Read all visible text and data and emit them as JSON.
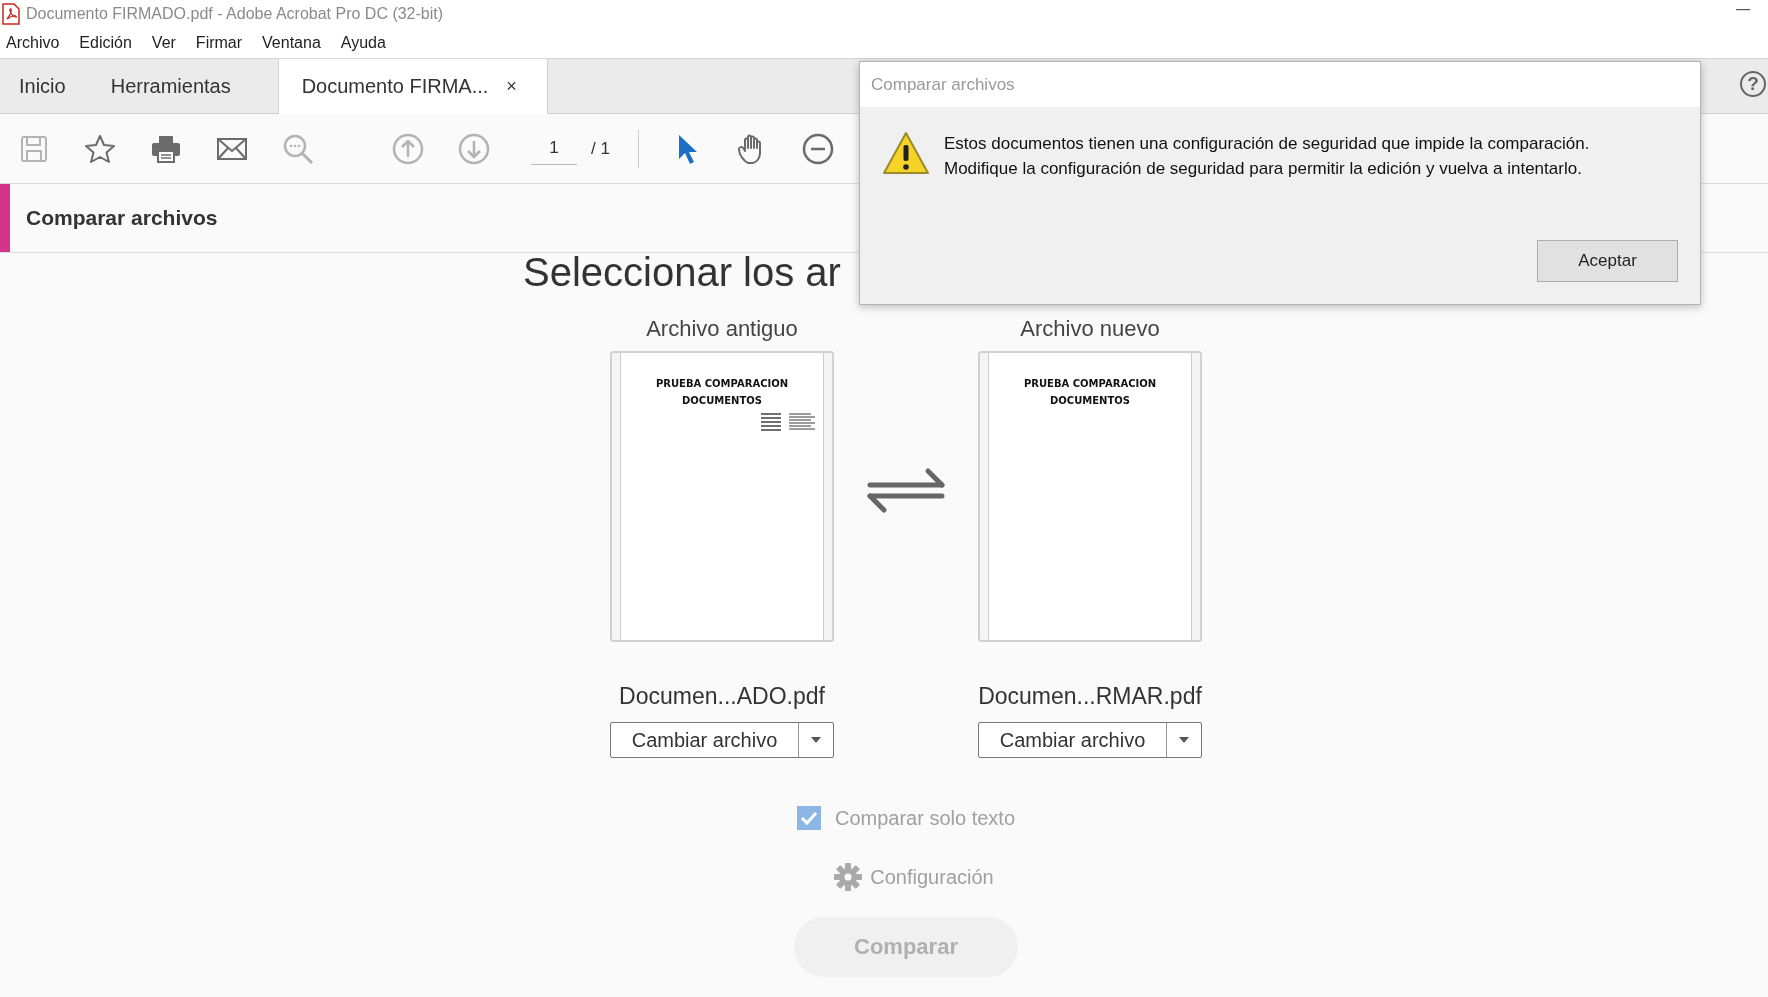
{
  "window": {
    "title": "Documento FIRMADO.pdf - Adobe Acrobat Pro DC (32-bit)"
  },
  "menu": [
    "Archivo",
    "Edición",
    "Ver",
    "Firmar",
    "Ventana",
    "Ayuda"
  ],
  "tabs": [
    {
      "label": "Inicio",
      "selected": false
    },
    {
      "label": "Herramientas",
      "selected": false
    },
    {
      "label": "Documento FIRMA...",
      "selected": true,
      "close": "×"
    }
  ],
  "help": "?",
  "toolbar": {
    "tools": [
      {
        "kind": "save",
        "disabled": true
      },
      {
        "kind": "star",
        "disabled": false
      },
      {
        "kind": "print",
        "disabled": false
      },
      {
        "kind": "mail",
        "disabled": false
      },
      {
        "kind": "search",
        "disabled": true
      },
      {
        "kind": "up",
        "disabled": true
      },
      {
        "kind": "down",
        "disabled": true
      },
      {
        "kind": "page"
      },
      {
        "kind": "separator"
      },
      {
        "kind": "pointer",
        "disabled": false,
        "selected": true
      },
      {
        "kind": "hand",
        "disabled": false,
        "selected": false
      },
      {
        "kind": "zoomout",
        "disabled": false
      }
    ],
    "page": "1",
    "page_total": "/ 1"
  },
  "tool_panel": {
    "title": "Comparar archivos"
  },
  "compare": {
    "heading": "Seleccionar los ar",
    "files": [
      {
        "label": "Archivo antiguo",
        "page_title": "PRUEBA COMPARACION DOCUMENTOS",
        "signature": true,
        "filename": "Documen...ADO.pdf",
        "button": "Cambiar archivo"
      },
      {
        "label": "Archivo nuevo",
        "page_title": "PRUEBA COMPARACION DOCUMENTOS",
        "signature": false,
        "filename": "Documen...RMAR.pdf",
        "button": "Cambiar archivo"
      }
    ],
    "text_only": {
      "label": "Comparar solo texto",
      "checked": true
    },
    "settings": "Configuración",
    "compare_button": {
      "label": "Comparar",
      "disabled": true
    }
  },
  "dialog": {
    "title": "Comparar archivos",
    "message": [
      "Estos documentos tienen una configuración de seguridad que impide la comparación.",
      "Modifique la configuración de seguridad para permitir la edición y vuelva a intentarlo."
    ],
    "button": "Aceptar"
  }
}
